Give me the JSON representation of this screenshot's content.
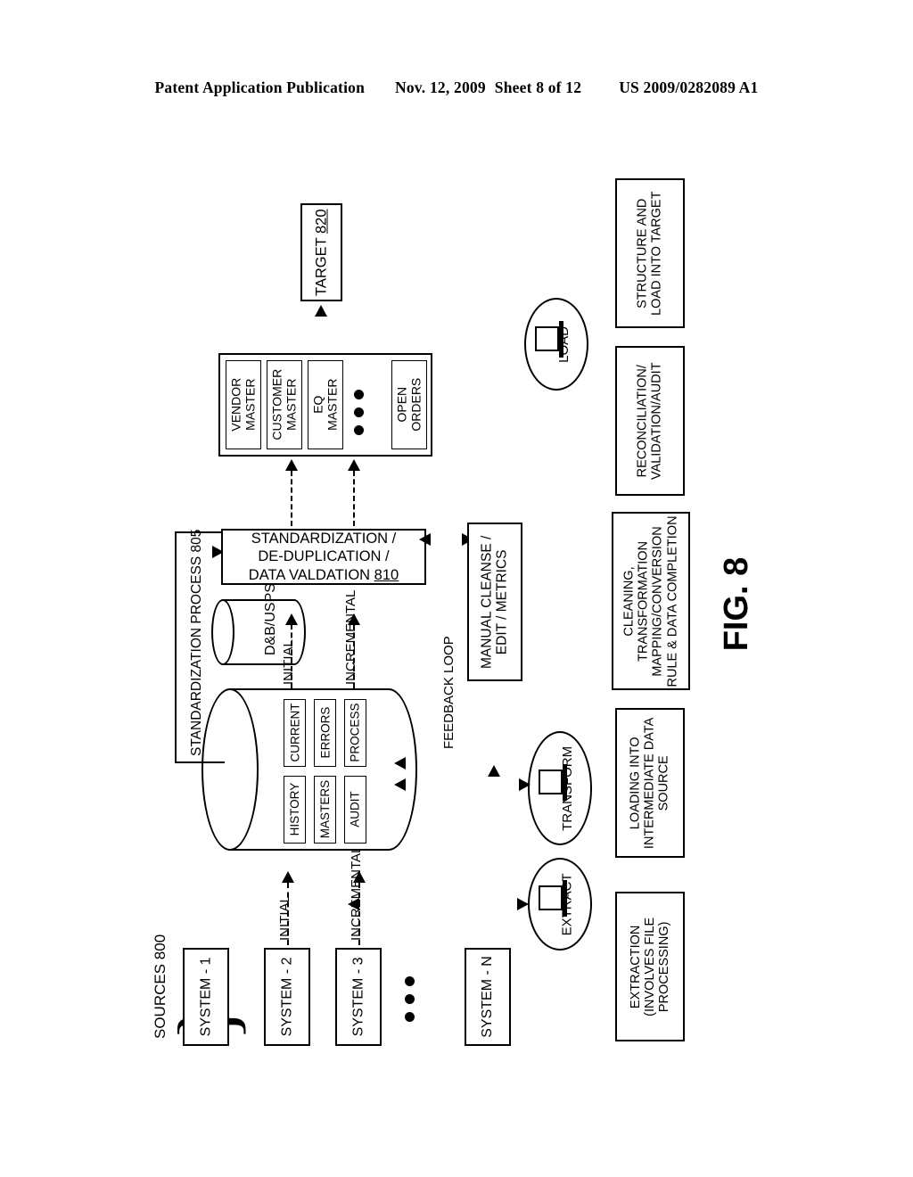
{
  "header": {
    "left": "Patent Application Publication",
    "date": "Nov. 12, 2009",
    "sheet": "Sheet 8 of 12",
    "pubnum": "US 2009/0282089 A1"
  },
  "figure": {
    "label": "FIG. 8",
    "sources_group_label": "SOURCES 800",
    "standardization_group_label": "STANDARDIZATION PROCESS 805",
    "feedback_loop_label": "FEEDBACK LOOP"
  },
  "sources": {
    "systems": [
      {
        "label": "SYSTEM - 1"
      },
      {
        "label": "SYSTEM - 2"
      },
      {
        "label": "SYSTEM - 3"
      },
      {
        "label": "SYSTEM - N"
      }
    ],
    "ellipsis": "• • •"
  },
  "flow_labels": {
    "initial_lower": "INITIAL",
    "incremental_lower": "INCREMENTAL",
    "initial_upper": "INITIAL",
    "incremental_upper": "INCREMENTAL"
  },
  "staging_db": {
    "cells_top": [
      {
        "label": "CURRENT"
      },
      {
        "label": "ERRORS"
      },
      {
        "label": "PROCESS"
      }
    ],
    "cells_bottom": [
      {
        "label": "HISTORY"
      },
      {
        "label": "MASTERS"
      },
      {
        "label": "AUDIT"
      }
    ]
  },
  "reference_db": {
    "label": "D&B/USPS"
  },
  "standardization_box": {
    "line1": "STANDARDIZATION /",
    "line2": "DE-DUPLICATION /",
    "line3": "DATA VALDATION ",
    "ref": "810"
  },
  "manual_box": {
    "line1": "MANUAL CLEANSE /",
    "line2": "EDIT / METRICS"
  },
  "masters_group": {
    "items": [
      {
        "line1": "VENDOR",
        "line2": "MASTER"
      },
      {
        "line1": "CUSTOMER",
        "line2": "MASTER"
      },
      {
        "line1": "EQ",
        "line2": "MASTER"
      },
      {
        "line1": "OPEN",
        "line2": "ORDERS"
      }
    ],
    "ellipsis": "• • •"
  },
  "target": {
    "label": "TARGET ",
    "ref": "820"
  },
  "etl_nodes": [
    {
      "label": "LOAD",
      "icon": "projector-icon"
    },
    {
      "label": "TRANSFORM",
      "icon": "projector-icon"
    },
    {
      "label": "EXTRACT",
      "icon": "projector-icon"
    }
  ],
  "descriptions": [
    {
      "lines": [
        "STRUCTURE AND",
        "LOAD INTO TARGET"
      ]
    },
    {
      "lines": [
        "RECONCILIATION/",
        "VALIDATION/AUDIT"
      ]
    },
    {
      "lines": [
        "CLEANING,",
        "TRANSFORMATION",
        "MAPPING/CONVERSION",
        "RULE & DATA COMPLETION"
      ]
    },
    {
      "lines": [
        "LOADING INTO",
        "INTERMEDIATE DATA",
        "SOURCE"
      ]
    },
    {
      "lines": [
        "EXTRACTION",
        "(INVOLVES FILE",
        "PROCESSING)"
      ]
    }
  ]
}
